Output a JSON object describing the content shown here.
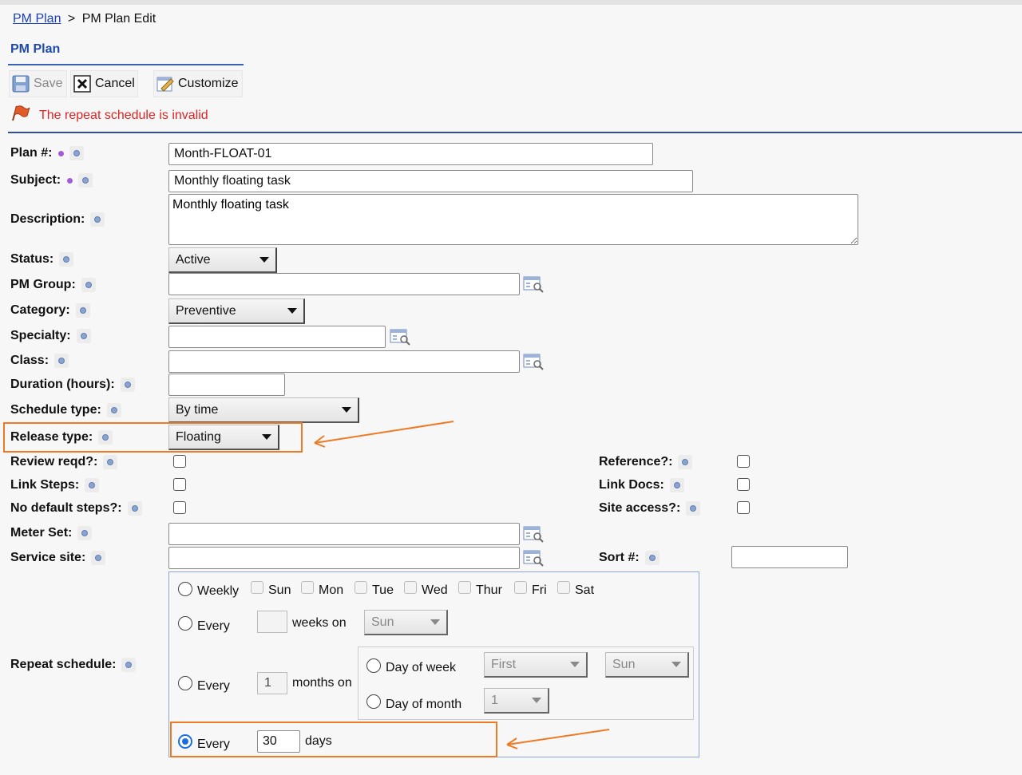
{
  "breadcrumb": {
    "link": "PM Plan",
    "separator": ">",
    "current": "PM Plan Edit"
  },
  "section_title": "PM Plan",
  "toolbar": {
    "save": "Save",
    "cancel": "Cancel",
    "customize": "Customize"
  },
  "error_message": "The repeat schedule is invalid",
  "fields": {
    "plan_no": {
      "label": "Plan #:",
      "value": "Month-FLOAT-01"
    },
    "subject": {
      "label": "Subject:",
      "value": "Monthly floating task"
    },
    "description": {
      "label": "Description:",
      "value": "Monthly floating task"
    },
    "status": {
      "label": "Status:",
      "value": "Active"
    },
    "pm_group": {
      "label": "PM Group:",
      "value": ""
    },
    "category": {
      "label": "Category:",
      "value": "Preventive"
    },
    "specialty": {
      "label": "Specialty:",
      "value": ""
    },
    "class": {
      "label": "Class:",
      "value": ""
    },
    "duration": {
      "label": "Duration (hours):",
      "value": ""
    },
    "schedule_type": {
      "label": "Schedule type:",
      "value": "By time"
    },
    "release_type": {
      "label": "Release type:",
      "value": "Floating"
    },
    "review_reqd": {
      "label": "Review reqd?:",
      "checked": false
    },
    "link_steps": {
      "label": "Link Steps:",
      "checked": false
    },
    "no_default_steps": {
      "label": "No default steps?:",
      "checked": false
    },
    "meter_set": {
      "label": "Meter Set:",
      "value": ""
    },
    "service_site": {
      "label": "Service site:",
      "value": ""
    },
    "reference": {
      "label": "Reference?:",
      "checked": false
    },
    "link_docs": {
      "label": "Link Docs:",
      "checked": false
    },
    "site_access": {
      "label": "Site access?:",
      "checked": false
    },
    "sort_no": {
      "label": "Sort #:",
      "value": ""
    }
  },
  "repeat_schedule": {
    "label": "Repeat schedule:",
    "weekly": {
      "label": "Weekly",
      "days": [
        "Sun",
        "Mon",
        "Tue",
        "Wed",
        "Thur",
        "Fri",
        "Sat"
      ]
    },
    "every_weeks": {
      "every": "Every",
      "value": "",
      "suffix": "weeks on",
      "day": "Sun"
    },
    "every_months": {
      "every": "Every",
      "value": "1",
      "suffix": "months on",
      "day_of_week": {
        "label": "Day of week",
        "ordinal": "First",
        "day": "Sun"
      },
      "day_of_month": {
        "label": "Day of month",
        "value": "1"
      }
    },
    "every_days": {
      "every": "Every",
      "value": "30",
      "suffix": "days",
      "selected": true
    }
  },
  "colors": {
    "accent": "#1f4aa8",
    "error": "#e02424",
    "highlight": "#f07a24"
  }
}
